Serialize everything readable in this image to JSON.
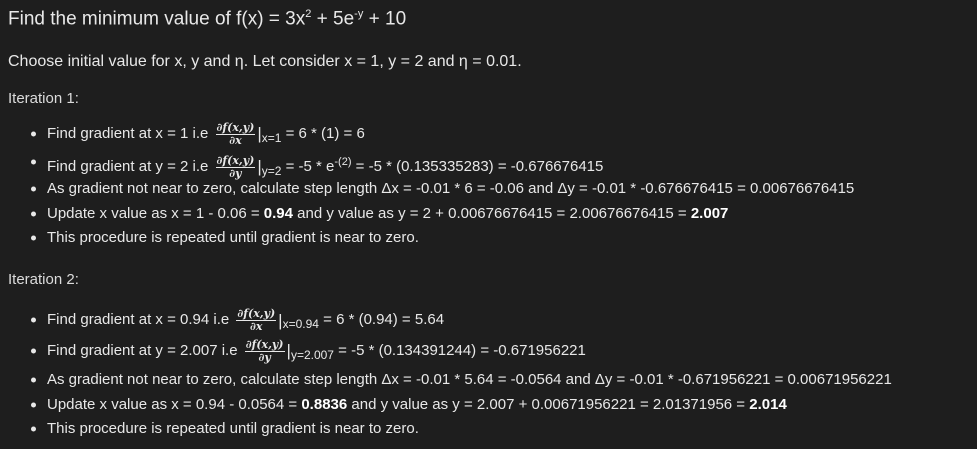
{
  "title": {
    "prefix": "Find the minimum value of f(x) = 3x",
    "exp1": "2",
    "mid": " + 5e",
    "exp2": "-y",
    "suffix": " + 10"
  },
  "intro": "Choose initial value for x, y and η. Let consider x = 1, y = 2 and η = 0.01.",
  "iterations": [
    {
      "heading": "Iteration 1:",
      "grad_x": {
        "pre": "Find gradient at x = 1 i.e ",
        "num": "∂f(x,y)",
        "den": "∂x",
        "bar": "|",
        "sub": "x=1",
        "post": " = 6 * (1) = 6"
      },
      "grad_y": {
        "pre": "Find gradient at y = 2 i.e ",
        "num": "∂f(x,y)",
        "den": "∂y",
        "bar": "|",
        "sub": "y=2",
        "mid": " = -5 * e",
        "exp": "-(2)",
        "post": " = -5 * (0.135335283) = -0.676676415"
      },
      "step": "As gradient not near to zero, calculate step length Δx = -0.01 * 6 = -0.06 and Δy = -0.01 * -0.676676415 = 0.00676676415",
      "update": {
        "pre": "Update x value as x = 1 - 0.06 = ",
        "x_bold": "0.94",
        "mid": " and y value as y = 2 + 0.00676676415 = 2.00676676415 = ",
        "y_bold": "2.007"
      },
      "repeat": "This procedure is repeated until gradient is near to zero."
    },
    {
      "heading": "Iteration 2:",
      "grad_x": {
        "pre": "Find gradient at x = 0.94 i.e ",
        "num": "∂f(x,y)",
        "den": "∂x",
        "bar": "|",
        "sub": "x=0.94",
        "post": " = 6 * (0.94) = 5.64"
      },
      "grad_y": {
        "pre": "Find gradient at y = 2.007 i.e ",
        "num": "∂f(x,y)",
        "den": "∂y",
        "bar": "|",
        "sub": "y=2.007",
        "post": " = -5 * (0.134391244) = -0.671956221"
      },
      "step": "As gradient not near to zero, calculate step length Δx = -0.01 * 5.64 = -0.0564 and Δy = -0.01 * -0.671956221 = 0.00671956221",
      "update": {
        "pre": "Update x value as x = 0.94 - 0.0564 = ",
        "x_bold": "0.8836",
        "mid": " and y value as y = 2.007 + 0.00671956221 = 2.01371956 = ",
        "y_bold": "2.014"
      },
      "repeat": "This procedure is repeated until gradient is near to zero."
    }
  ]
}
